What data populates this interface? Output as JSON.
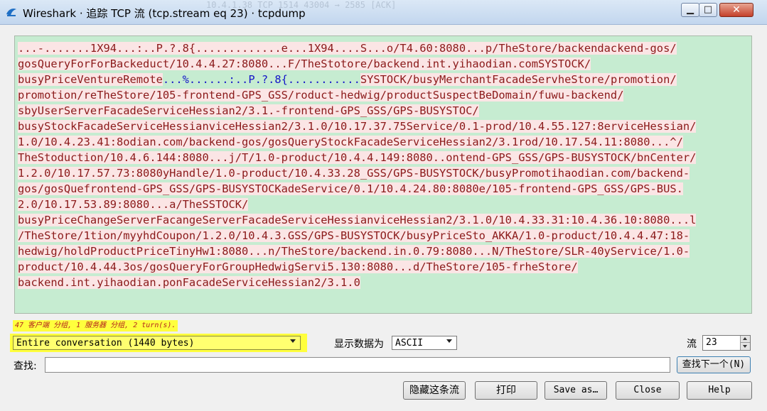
{
  "window": {
    "title": "Wireshark · 追踪 TCP 流 (tcp.stream eq 23) · tcpdump",
    "background_text": "10.4.1.38        TCP      1514 43004 → 2585 [ACK]"
  },
  "stream": {
    "lines": [
      [
        [
          "c",
          "...-.......1X94...:..P.?.8{.............e...1X94....S...o/T4.60:8080...p/TheStore/backendackend-gos/"
        ]
      ],
      [
        [
          "c",
          "gosQueryForForBackeduct/10.4.4.27:8080...F/TheStotore/backend.int.yihaodian.comSYSTOCK/"
        ]
      ],
      [
        [
          "c",
          "busyPriceVentureRemote"
        ],
        [
          "s",
          "...%......:..P.?.8{..........."
        ],
        [
          "c",
          "SYSTOCK/busyMerchantFacadeServheStore/promotion/"
        ]
      ],
      [
        [
          "c",
          "promotion/reTheStore/105-frontend-GPS_GSS/roduct-hedwig/productSuspectBeDomain/fuwu-backend/"
        ]
      ],
      [
        [
          "c",
          "sbyUserServerFacadeServiceHessian2/3.1.-frontend-GPS_GSS/GPS-BUSYSTOC/"
        ]
      ],
      [
        [
          "c",
          "busyStockFacadeServiceHessianviceHessian2/3.1.0/10.17.37.75Service/0.1-prod/10.4.55.127:8erviceHessian/"
        ]
      ],
      [
        [
          "c",
          "1.0/10.4.23.41:8odian.com/backend-gos/gosQueryStockFacadeServiceHessian2/3.1rod/10.17.54.11:8080...^/"
        ]
      ],
      [
        [
          "c",
          "TheStoduction/10.4.6.144:8080...j/T/1.0-product/10.4.4.149:8080..ontend-GPS_GSS/GPS-BUSYSTOCK/bnCenter/"
        ]
      ],
      [
        [
          "c",
          "1.2.0/10.17.57.73:8080yHandle/1.0-product/10.4.33.28_GSS/GPS-BUSYSTOCK/busyPromotihaodian.com/backend-"
        ]
      ],
      [
        [
          "c",
          "gos/gosQuefrontend-GPS_GSS/GPS-BUSYSTOCKadeService/0.1/10.4.24.80:8080e/105-frontend-GPS_GSS/GPS-BUS."
        ]
      ],
      [
        [
          "c",
          "2.0/10.17.53.89:8080...a/TheSSTOCK/"
        ]
      ],
      [
        [
          "c",
          "busyPriceChangeServerFacangeServerFacadeServiceHessianviceHessian2/3.1.0/10.4.33.31:10.4.36.10:8080...l"
        ]
      ],
      [
        [
          "c",
          "/TheStore/1tion/myyhdCoupon/1.2.0/10.4.3.GSS/GPS-BUSYSTOCK/busyPriceSto_AKKA/1.0-product/10.4.4.47:18-"
        ]
      ],
      [
        [
          "c",
          "hedwig/holdProductPriceTinyHw1:8080...n/TheStore/backend.in.0.79:8080...N/TheStore/SLR-40yService/1.0-"
        ]
      ],
      [
        [
          "c",
          "product/10.4.44.3os/gosQueryForGroupHedwigServi5.130:8080...d/TheStore/105-frheStore/"
        ]
      ],
      [
        [
          "c",
          "backend.int.yihaodian.ponFacadeServiceHessian2/3.1.0"
        ]
      ]
    ]
  },
  "summary": "47 客户端 分组, 1 服务器 分组, 2 turn(s).",
  "conversation": {
    "selected": "Entire conversation (1440 bytes)"
  },
  "format": {
    "label": "显示数据为",
    "selected": "ASCII"
  },
  "stream_no": {
    "label": "流",
    "value": "23"
  },
  "find": {
    "label": "查找:",
    "value": "",
    "next_button": "查找下一个(N)"
  },
  "buttons": {
    "hide": "隐藏这条流",
    "print": "打印",
    "save_as": "Save as…",
    "close": "Close",
    "help": "Help"
  },
  "colors": {
    "client_bg": "#fbe5e5",
    "client_fg": "#8b1a1a",
    "server_bg": "#c6ecd1",
    "server_fg": "#1515c8",
    "highlight": "#ffff3d"
  }
}
